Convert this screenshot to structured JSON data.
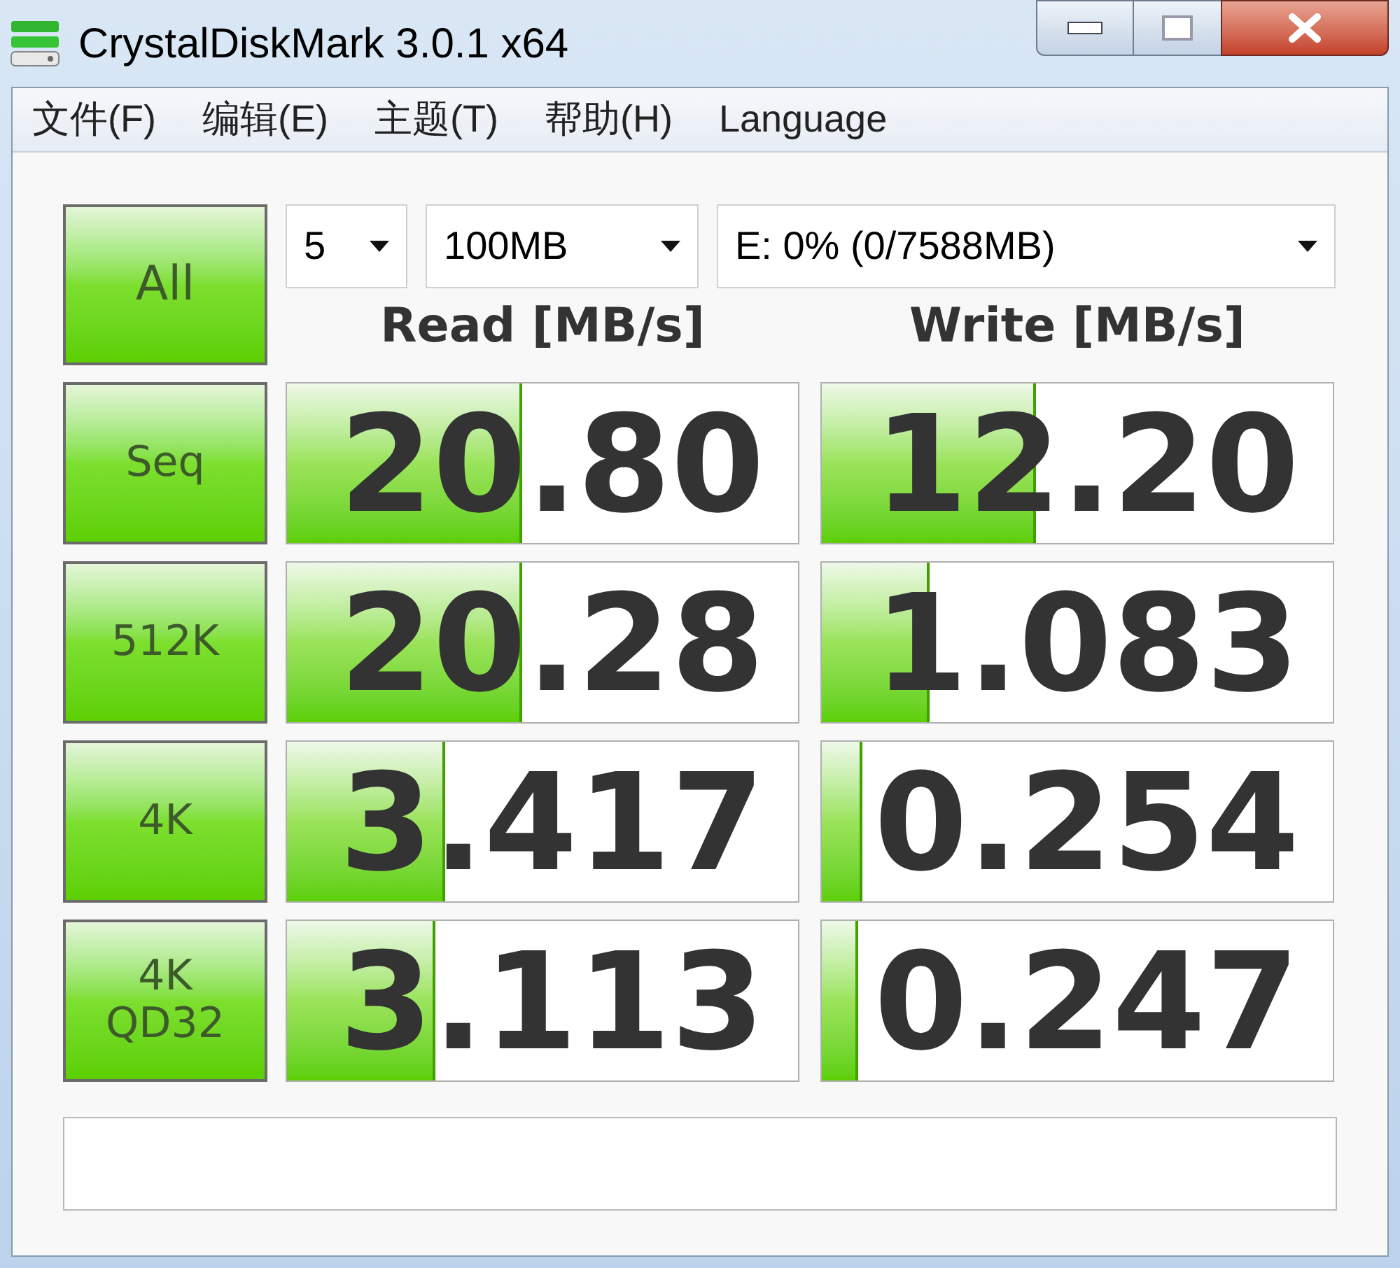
{
  "window": {
    "title": "CrystalDiskMark 3.0.1 x64"
  },
  "menu": [
    "文件(F)",
    "编辑(E)",
    "主题(T)",
    "帮助(H)",
    "Language"
  ],
  "settings": {
    "count": "5",
    "size": "100MB",
    "drive": "E: 0% (0/7588MB)"
  },
  "all_button": "All",
  "headers": [
    "Read [MB/s]",
    "Write [MB/s]"
  ],
  "rows": [
    {
      "label": "Seq",
      "read": {
        "value": "20.80",
        "level": 0.46
      },
      "write": {
        "value": "12.20",
        "level": 0.42
      }
    },
    {
      "label": "512K",
      "read": {
        "value": "20.28",
        "level": 0.46
      },
      "write": {
        "value": "1.083",
        "level": 0.21
      }
    },
    {
      "label": "4K",
      "read": {
        "value": "3.417",
        "level": 0.31
      },
      "write": {
        "value": "0.254",
        "level": 0.08
      }
    },
    {
      "label": "4K QD32",
      "read": {
        "value": "3.113",
        "level": 0.29
      },
      "write": {
        "value": "0.247",
        "level": 0.07
      }
    }
  ]
}
